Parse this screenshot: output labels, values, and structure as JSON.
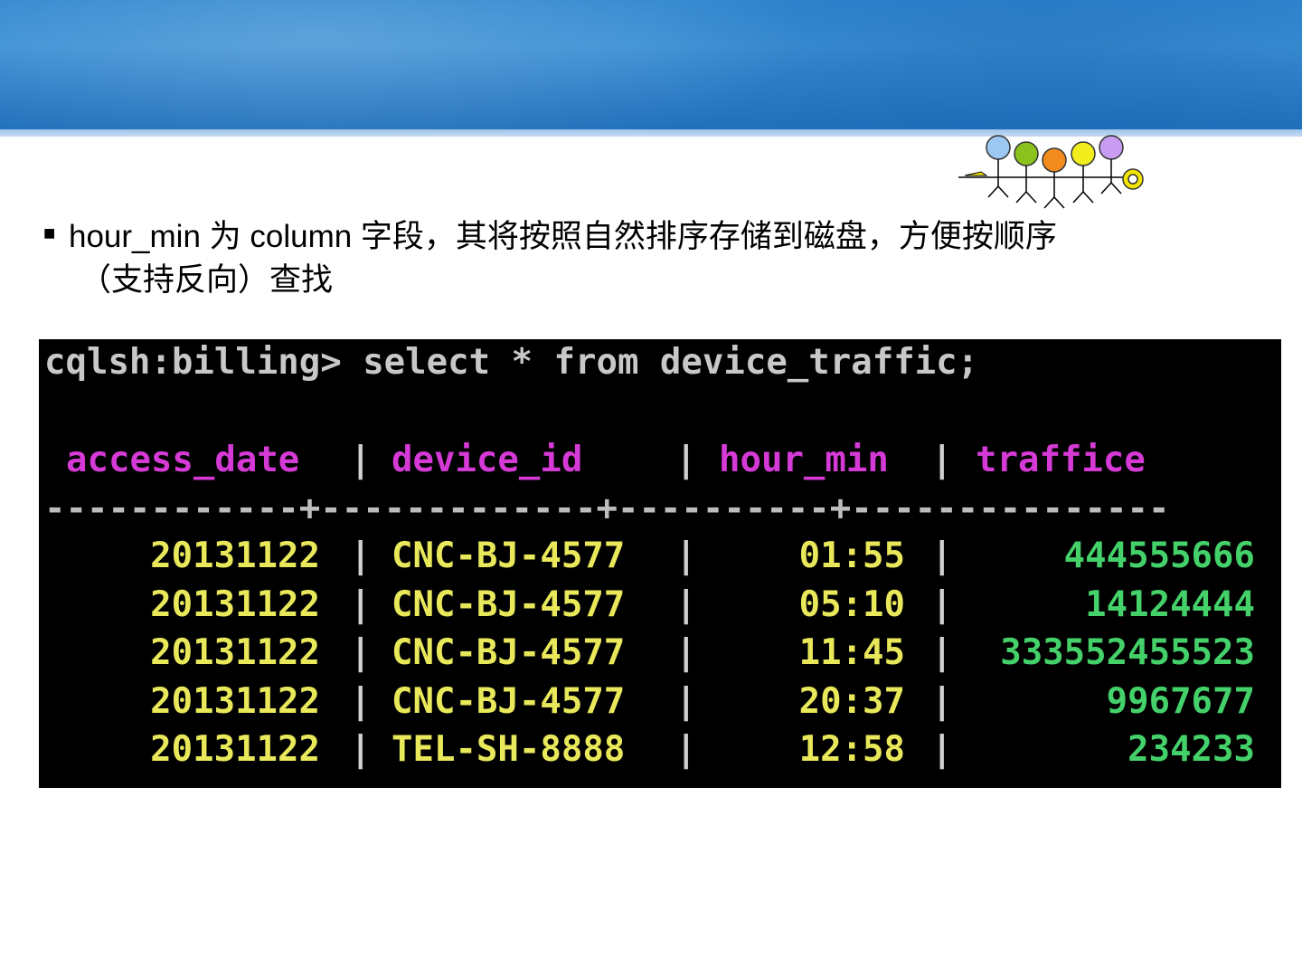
{
  "bullet": {
    "line1": "hour_min 为 column 字段，其将按照自然排序存储到磁盘，方便按顺序",
    "line2": "（支持反向）查找"
  },
  "terminal": {
    "prompt": "cqlsh:billing> select * from device_traffic;",
    "headers": [
      "access_date",
      "device_id",
      "hour_min",
      "traffice"
    ],
    "rows": [
      {
        "access_date": "20131122",
        "device_id": "CNC-BJ-4577",
        "hour_min": "01:55",
        "traffice": "444555666"
      },
      {
        "access_date": "20131122",
        "device_id": "CNC-BJ-4577",
        "hour_min": "05:10",
        "traffice": "14124444"
      },
      {
        "access_date": "20131122",
        "device_id": "CNC-BJ-4577",
        "hour_min": "11:45",
        "traffice": "333552455523"
      },
      {
        "access_date": "20131122",
        "device_id": "CNC-BJ-4577",
        "hour_min": "20:37",
        "traffice": "9967677"
      },
      {
        "access_date": "20131122",
        "device_id": "TEL-SH-8888",
        "hour_min": "12:58",
        "traffice": "234233"
      }
    ],
    "separator_bar": "|",
    "dash_line": "------------+-------------+----------+---------------"
  },
  "colors": {
    "header_band": "#2b7cc6",
    "terminal_bg": "#000000",
    "header_text": "#d63ad6",
    "key_text": "#e8e85a",
    "value_text": "#44d16a"
  },
  "icons": {
    "logo": "people-figures-logo"
  }
}
